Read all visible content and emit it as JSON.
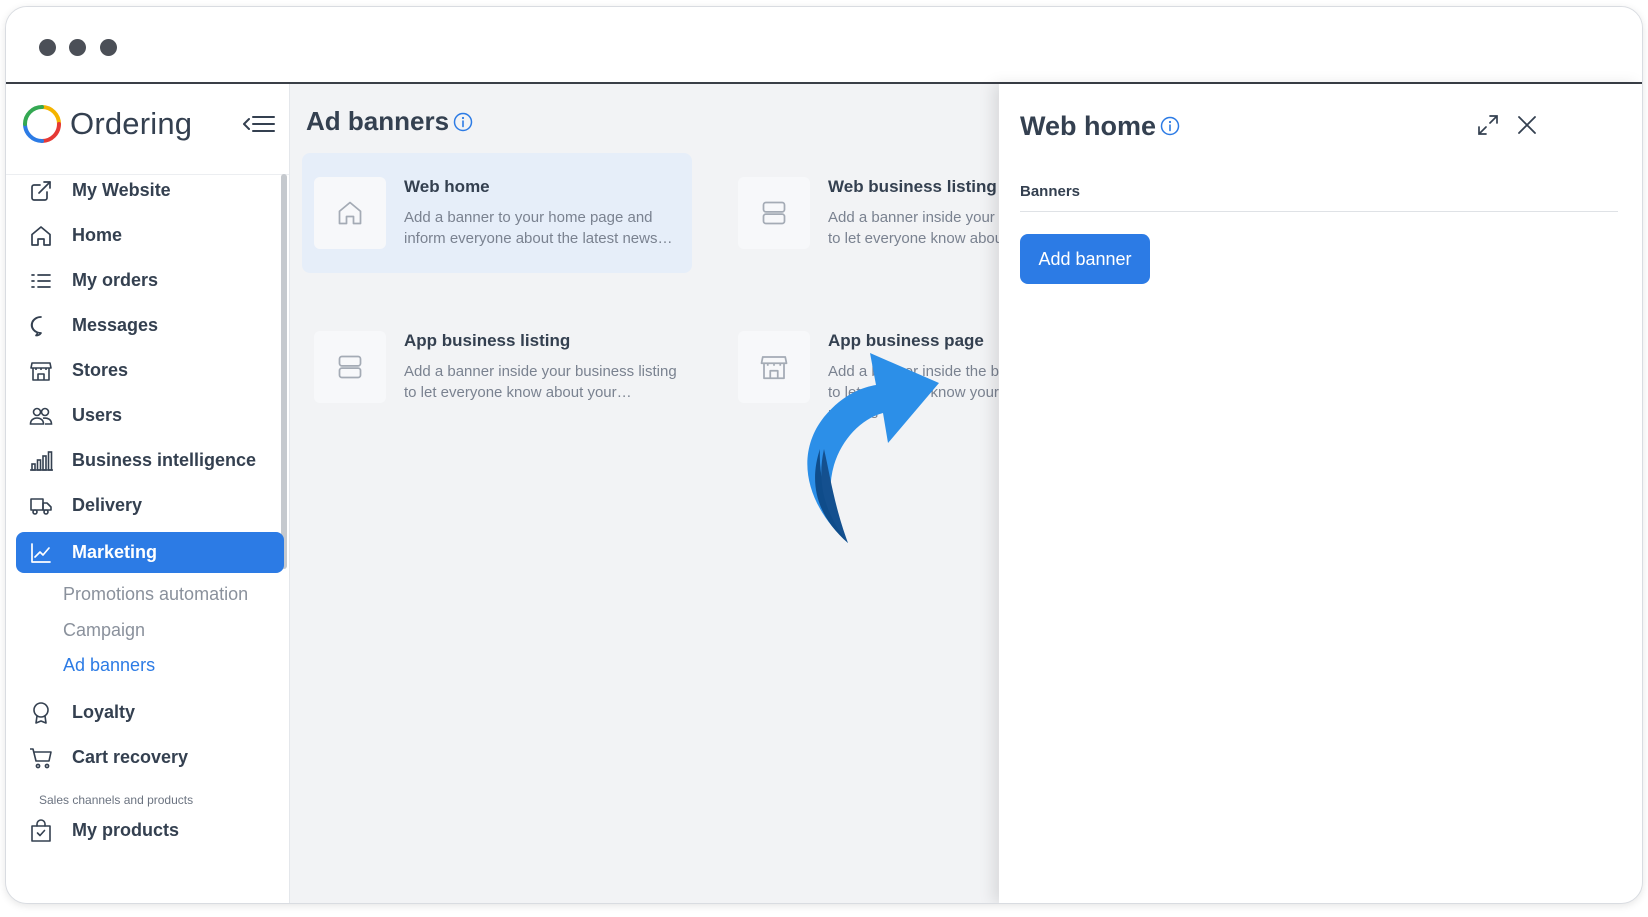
{
  "brand": {
    "name": "Ordering"
  },
  "sidebar": {
    "items": [
      {
        "label": "My Website",
        "icon": "external-link-icon"
      },
      {
        "label": "Home",
        "icon": "home-icon"
      },
      {
        "label": "My orders",
        "icon": "list-icon"
      },
      {
        "label": "Messages",
        "icon": "chat-icon"
      },
      {
        "label": "Stores",
        "icon": "shop-icon"
      },
      {
        "label": "Users",
        "icon": "users-icon"
      },
      {
        "label": "Business intelligence",
        "icon": "bar-chart-icon"
      },
      {
        "label": "Delivery",
        "icon": "truck-icon"
      },
      {
        "label": "Marketing",
        "icon": "line-chart-icon",
        "active": true
      }
    ],
    "marketing_sub": [
      "Promotions automation",
      "Campaign",
      "Ad banners"
    ],
    "marketing_sub_active": "Ad banners",
    "items_after": [
      {
        "label": "Loyalty",
        "icon": "award-icon"
      },
      {
        "label": "Cart recovery",
        "icon": "cart-icon"
      }
    ],
    "section_label": "Sales channels and products",
    "section_items": [
      {
        "label": "My products",
        "icon": "bag-check-icon"
      }
    ]
  },
  "main": {
    "title": "Ad banners",
    "cards": [
      {
        "title": "Web home",
        "desc": "Add a banner to your home page and inform everyone about the latest news…",
        "icon": "home-icon",
        "selected": true
      },
      {
        "title": "Web business listing",
        "desc": "Add a banner inside your business listing to let everyone know about your…",
        "icon": "list-layout-icon"
      },
      {
        "title": "App business listing",
        "desc": "Add a banner inside your business listing to let everyone know about your…",
        "icon": "list-layout-icon"
      },
      {
        "title": "App business page",
        "desc": "Add a banner inside the business page to let everyone know your news and promos",
        "icon": "shop-icon"
      }
    ]
  },
  "panel": {
    "title": "Web home",
    "tab": "Banners",
    "add_button": "Add banner"
  },
  "colors": {
    "accent": "#2c7be5",
    "text": "#344050",
    "muted": "#7a8290",
    "selected_card": "#e6eef9"
  }
}
